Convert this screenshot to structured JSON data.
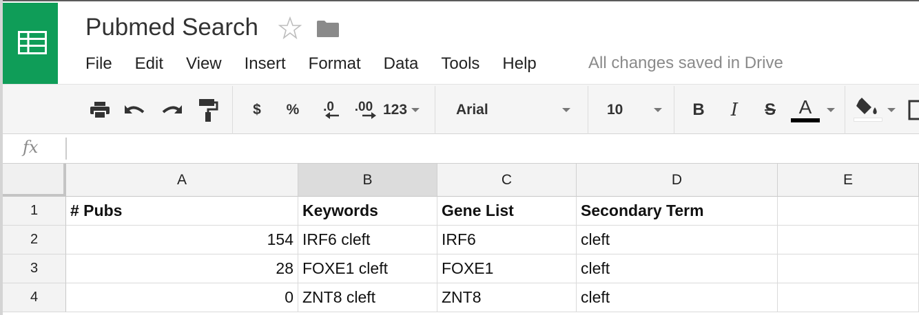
{
  "app": {
    "title": "Pubmed Search",
    "brand_color": "#0f9d58",
    "logo_icon": "sheets-grid-icon",
    "star_icon": "star-outline-icon",
    "folder_icon": "folder-icon",
    "save_status": "All changes saved in Drive"
  },
  "menu": [
    "File",
    "Edit",
    "View",
    "Insert",
    "Format",
    "Data",
    "Tools",
    "Help"
  ],
  "toolbar": {
    "currency": "$",
    "percent": "%",
    "decrease_decimal": ".0",
    "increase_decimal": ".00",
    "more_formats": "123",
    "font_family": "Arial",
    "font_size": "10",
    "bold": "B",
    "italic": "I",
    "strike": "S",
    "text_color": "A",
    "text_color_value": "#000000",
    "fill_color_value": "#ffffff"
  },
  "formula_bar": {
    "icon": "fx",
    "value": ""
  },
  "sheet": {
    "columns": [
      "A",
      "B",
      "C",
      "D",
      "E"
    ],
    "selected_column": "B",
    "rows": [
      {
        "n": "1",
        "cells": [
          "# Pubs",
          "Keywords",
          "Gene List",
          "Secondary Term",
          ""
        ]
      },
      {
        "n": "2",
        "cells": [
          "154",
          "IRF6 cleft",
          "IRF6",
          "cleft",
          ""
        ]
      },
      {
        "n": "3",
        "cells": [
          "28",
          "FOXE1 cleft",
          "FOXE1",
          "cleft",
          ""
        ]
      },
      {
        "n": "4",
        "cells": [
          "0",
          "ZNT8 cleft",
          "ZNT8",
          "cleft",
          ""
        ]
      }
    ]
  }
}
